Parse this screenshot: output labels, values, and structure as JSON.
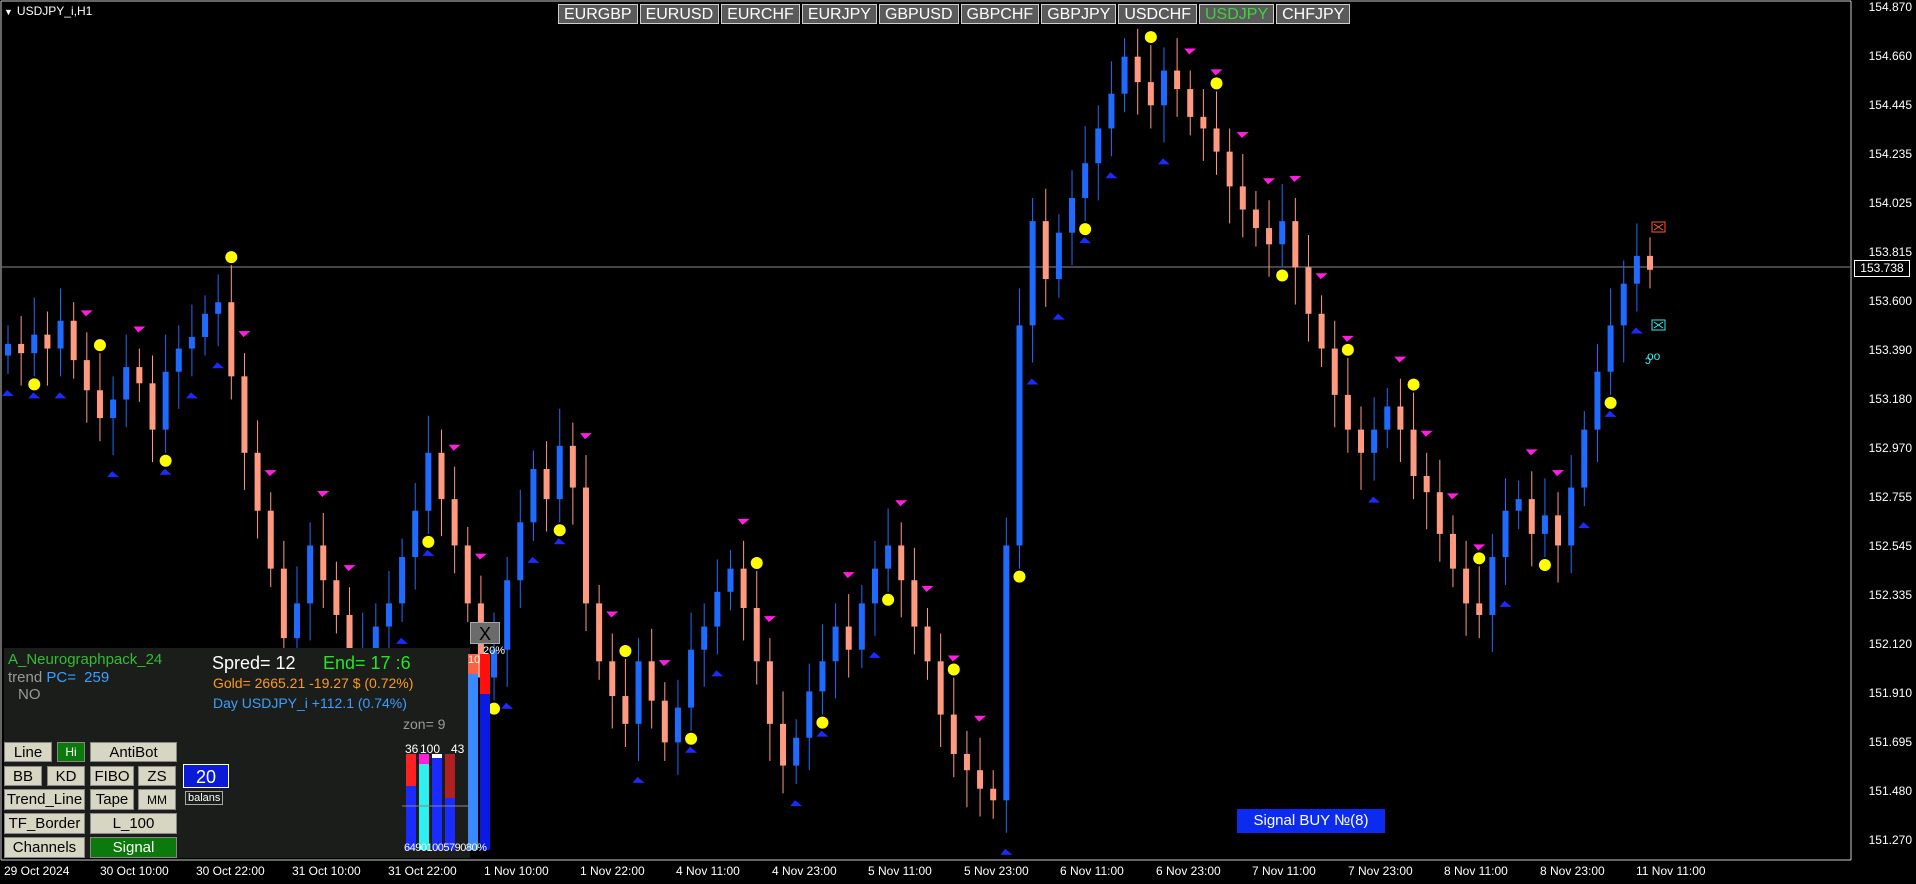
{
  "window": {
    "symbol_title": "USDJPY_i,H1"
  },
  "pairs": [
    {
      "label": "EURGBP",
      "active": false
    },
    {
      "label": "EURUSD",
      "active": false
    },
    {
      "label": "EURCHF",
      "active": false
    },
    {
      "label": "EURJPY",
      "active": false
    },
    {
      "label": "GBPUSD",
      "active": false
    },
    {
      "label": "GBPCHF",
      "active": false
    },
    {
      "label": "GBPJPY",
      "active": false
    },
    {
      "label": "USDCHF",
      "active": false
    },
    {
      "label": "USDJPY",
      "active": true
    },
    {
      "label": "CHFJPY",
      "active": false
    }
  ],
  "price_axis": [
    "154.870",
    "154.660",
    "154.445",
    "154.235",
    "154.025",
    "153.815",
    "153.600",
    "153.390",
    "153.180",
    "152.970",
    "152.755",
    "152.545",
    "152.335",
    "152.120",
    "151.910",
    "151.695",
    "151.480",
    "151.270"
  ],
  "current_price": "153.738",
  "time_axis": [
    "29 Oct 2024",
    "30 Oct 10:00",
    "30 Oct 22:00",
    "31 Oct 10:00",
    "31 Oct 22:00",
    "1 Nov 10:00",
    "1 Nov 22:00",
    "4 Nov 11:00",
    "4 Nov 23:00",
    "5 Nov 11:00",
    "5 Nov 23:00",
    "6 Nov 11:00",
    "6 Nov 23:00",
    "7 Nov 11:00",
    "7 Nov 23:00",
    "8 Nov 11:00",
    "8 Nov 23:00",
    "11 Nov 11:00"
  ],
  "chart_data": {
    "type": "candlestick",
    "symbol": "USDJPY_i",
    "timeframe": "H1",
    "ylim": [
      151.27,
      154.87
    ],
    "close_series": [
      153.42,
      153.38,
      153.46,
      153.4,
      153.52,
      153.35,
      153.22,
      153.1,
      153.18,
      153.32,
      153.25,
      153.05,
      153.3,
      153.4,
      153.45,
      153.55,
      153.6,
      153.28,
      152.95,
      152.7,
      152.45,
      152.15,
      152.3,
      152.55,
      152.4,
      152.25,
      152.05,
      152.1,
      152.2,
      152.3,
      152.5,
      152.7,
      152.95,
      152.75,
      152.55,
      152.3,
      151.98,
      152.1,
      152.4,
      152.65,
      152.88,
      152.75,
      152.98,
      152.8,
      152.3,
      152.05,
      151.9,
      151.78,
      152.05,
      151.88,
      151.7,
      151.85,
      152.1,
      152.2,
      152.35,
      152.45,
      152.28,
      152.05,
      151.78,
      151.6,
      151.72,
      151.92,
      152.05,
      152.2,
      152.1,
      152.3,
      152.45,
      152.55,
      152.4,
      152.2,
      152.05,
      151.82,
      151.65,
      151.58,
      151.5,
      151.45,
      152.55,
      153.5,
      153.95,
      153.7,
      153.9,
      154.05,
      154.2,
      154.35,
      154.5,
      154.66,
      154.55,
      154.45,
      154.6,
      154.52,
      154.4,
      154.35,
      154.25,
      154.1,
      154.0,
      153.92,
      153.85,
      153.95,
      153.75,
      153.55,
      153.4,
      153.2,
      153.05,
      152.95,
      153.05,
      153.15,
      153.05,
      152.85,
      152.78,
      152.6,
      152.45,
      152.3,
      152.25,
      152.5,
      152.7,
      152.75,
      152.6,
      152.68,
      152.55,
      152.8,
      153.05,
      153.3,
      153.5,
      153.68,
      153.8,
      153.74
    ],
    "signal_markers": {
      "yellow_dots": 27,
      "magenta_arrows_down": true,
      "blue_arrows_up": true
    }
  },
  "panel": {
    "indicator_name": "A_Neurographpack_24",
    "trend_label": "trend",
    "pc_label": "PC=",
    "pc_value": "259",
    "status": "NO",
    "spread": "Spred= 12",
    "end": "End= 17 :6",
    "gold": "Gold= 2665.21 -19.27 $ (0.72%)",
    "day": "Day USDJPY_i  +112.1 (0.74%)",
    "zon": "zon= 9",
    "close_label": "X",
    "buttons": {
      "line": "Line",
      "hi": "Hi",
      "antibot": "AntiBot",
      "bb": "BB",
      "kd": "KD",
      "fibo": "FIBO",
      "zs": "ZS",
      "trend_line": "Trend_Line",
      "tape": "Tape",
      "mm": "MM",
      "tf_border": "TF_Border",
      "l100": "L_100",
      "channels": "Channels",
      "signal": "Signal"
    },
    "balans_value": "20",
    "balans_label": "balans",
    "mini_bars": {
      "top_labels": [
        "36",
        "100",
        "43"
      ],
      "bottom_labels": [
        "64",
        "90",
        "100",
        "57",
        "90",
        "80%"
      ],
      "big_top_left": "10",
      "big_top_right": "20%"
    }
  },
  "signal_banner": "Signal BUY №(8)",
  "colors": {
    "bull": "#1f6bff",
    "bear": "#ff9a80",
    "down_arrow": "#ff1ee0",
    "up_arrow": "#1a2bff",
    "dot": "#ffff00"
  }
}
